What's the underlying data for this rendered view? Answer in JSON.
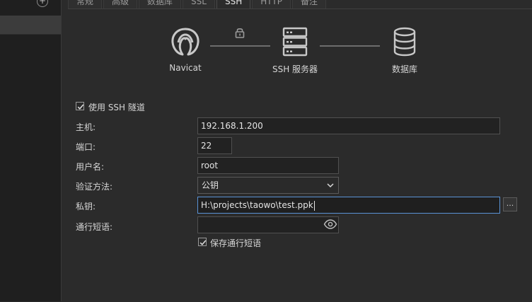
{
  "tabs": [
    {
      "label": "常规"
    },
    {
      "label": "高级"
    },
    {
      "label": "数据库"
    },
    {
      "label": "SSL"
    },
    {
      "label": "SSH",
      "active": true
    },
    {
      "label": "HTTP"
    },
    {
      "label": "备注"
    }
  ],
  "diagram": {
    "client_label": "Navicat",
    "server_label": "SSH 服务器",
    "database_label": "数据库"
  },
  "form": {
    "use_ssh_tunnel": {
      "label": "使用 SSH 隧道",
      "checked": true
    },
    "host": {
      "label": "主机:",
      "value": "192.168.1.200"
    },
    "port": {
      "label": "端口:",
      "value": "22"
    },
    "username": {
      "label": "用户名:",
      "value": "root"
    },
    "auth_method": {
      "label": "验证方法:",
      "value": "公钥"
    },
    "private_key": {
      "label": "私钥:",
      "value": "H:\\projects\\taowo\\test.ppk",
      "browse_label": "..."
    },
    "passphrase": {
      "label": "通行短语:",
      "value": ""
    },
    "save_passphrase": {
      "label": "保存通行短语",
      "checked": true
    }
  },
  "icons": {
    "add": "add-circle-icon",
    "lock": "lock-icon",
    "server": "server-icon",
    "database": "database-icon",
    "eye": "eye-icon",
    "dropdown": "chevron-down-icon"
  }
}
